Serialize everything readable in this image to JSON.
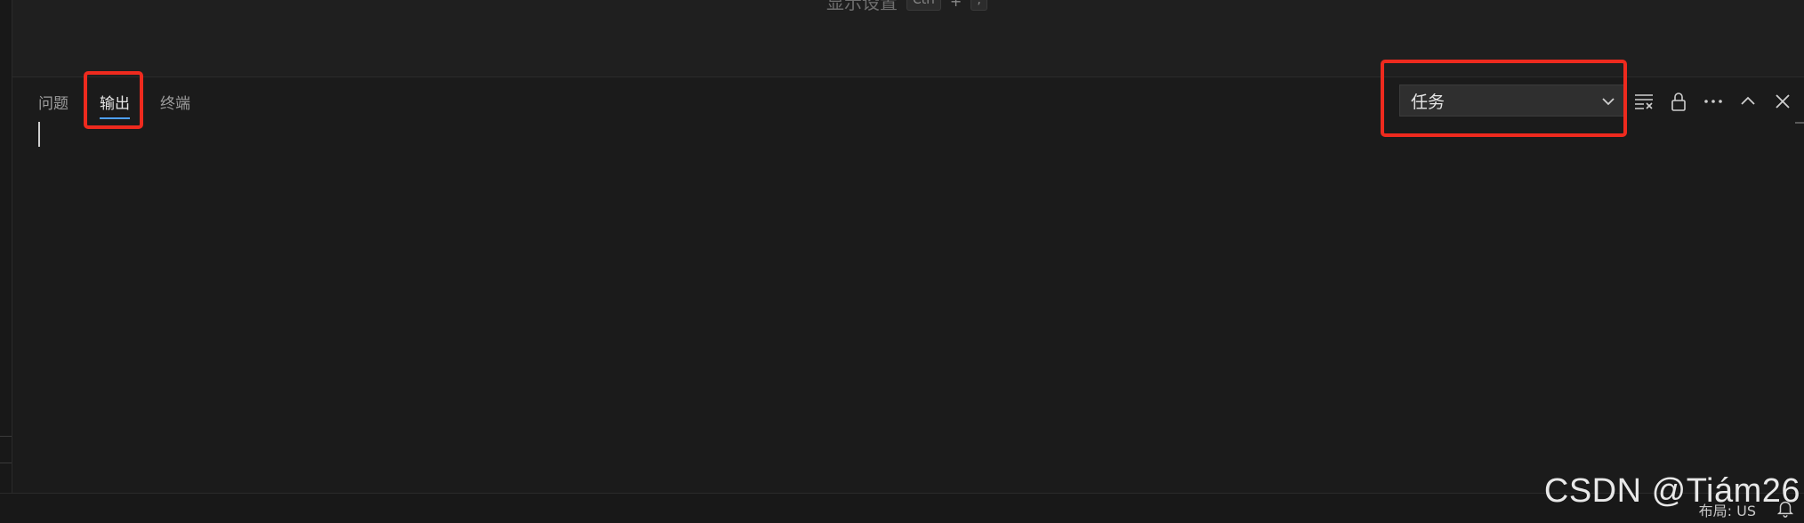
{
  "editor": {
    "hint_text": "显示设置",
    "hint_keys": [
      "Ctrl",
      "+",
      ","
    ]
  },
  "panel": {
    "tabs": [
      {
        "label": "问题",
        "active": false
      },
      {
        "label": "输出",
        "active": true
      },
      {
        "label": "终端",
        "active": false
      }
    ],
    "output_channel": {
      "selected": "任务"
    },
    "actions": [
      {
        "name": "clear-output-icon"
      },
      {
        "name": "lock-scroll-icon"
      },
      {
        "name": "more-actions-icon"
      },
      {
        "name": "maximize-panel-icon"
      },
      {
        "name": "close-panel-icon"
      }
    ]
  },
  "status_bar": {
    "layout_label": "布局: US",
    "bell_icon": "bell-icon"
  },
  "watermark": "CSDN @Tiám26",
  "colors": {
    "highlight": "#ee2a1e",
    "active_tab_underline": "#4ea0ff",
    "background": "#1b1b1b"
  }
}
